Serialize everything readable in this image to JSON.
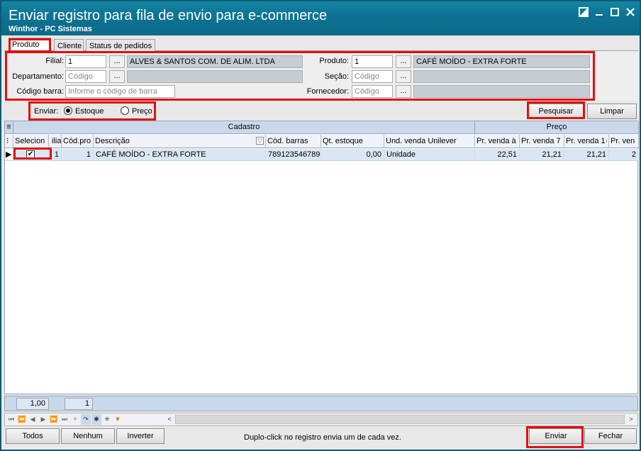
{
  "window": {
    "title": "Enviar registro para fila de envio para e-commerce",
    "subtitle": "Winthor - PC Sistemas"
  },
  "tabs": [
    {
      "label": "Produto",
      "active": true
    },
    {
      "label": "Cliente",
      "active": false
    },
    {
      "label": "Status de pedidos",
      "active": false
    }
  ],
  "filters": {
    "filial_label": "Filial:",
    "filial_value": "1",
    "filial_name": "ALVES & SANTOS COM. DE ALIM. LTDA",
    "departamento_label": "Departamento:",
    "departamento_placeholder": "Código",
    "codigo_barra_label": "Código barra:",
    "codigo_barra_placeholder": "Informe o código de barra",
    "produto_label": "Produto:",
    "produto_value": "1",
    "produto_name": "CAFÉ MOÍDO - EXTRA FORTE",
    "secao_label": "Seção:",
    "secao_placeholder": "Código",
    "fornecedor_label": "Fornecedor:",
    "fornecedor_placeholder": "Código",
    "dots": "..."
  },
  "enviar": {
    "label": "Enviar:",
    "options": [
      "Estoque",
      "Preço"
    ],
    "selected": "Estoque"
  },
  "actions": {
    "pesquisar": "Pesquisar",
    "limpar": "Limpar"
  },
  "grid": {
    "bands": [
      "Cadastro",
      "Preço"
    ],
    "columns": [
      "Selecion",
      "ilia",
      "Cód.pro",
      "Descrição",
      "Cód. barras",
      "Qt. estoque",
      "Und. venda Unilever",
      "Pr. venda à",
      "Pr. venda 7",
      "Pr. venda 1·",
      "Pr. ven"
    ],
    "rows": [
      {
        "checked": true,
        "filial": "1",
        "codprod": "1",
        "descricao": "CAFÉ MOÍDO - EXTRA FORTE",
        "cod_barras": "789123546789",
        "qt_estoque": "0,00",
        "und_venda": "Unidade",
        "pv_a": "22,51",
        "pv_7": "21,21",
        "pv_1": "21,21",
        "pv_x": "2"
      }
    ]
  },
  "footer": {
    "sum1": "1,00",
    "sum2": "1"
  },
  "bottom": {
    "todos": "Todos",
    "nenhum": "Nenhum",
    "inverter": "Inverter",
    "hint": "Duplo-click no registro envia um de cada vez.",
    "enviar": "Enviar",
    "fechar": "Fechar"
  },
  "colors": {
    "titlebar": "#0e7393",
    "highlight": "#e01010",
    "grid_header": "#c9d9ec"
  }
}
